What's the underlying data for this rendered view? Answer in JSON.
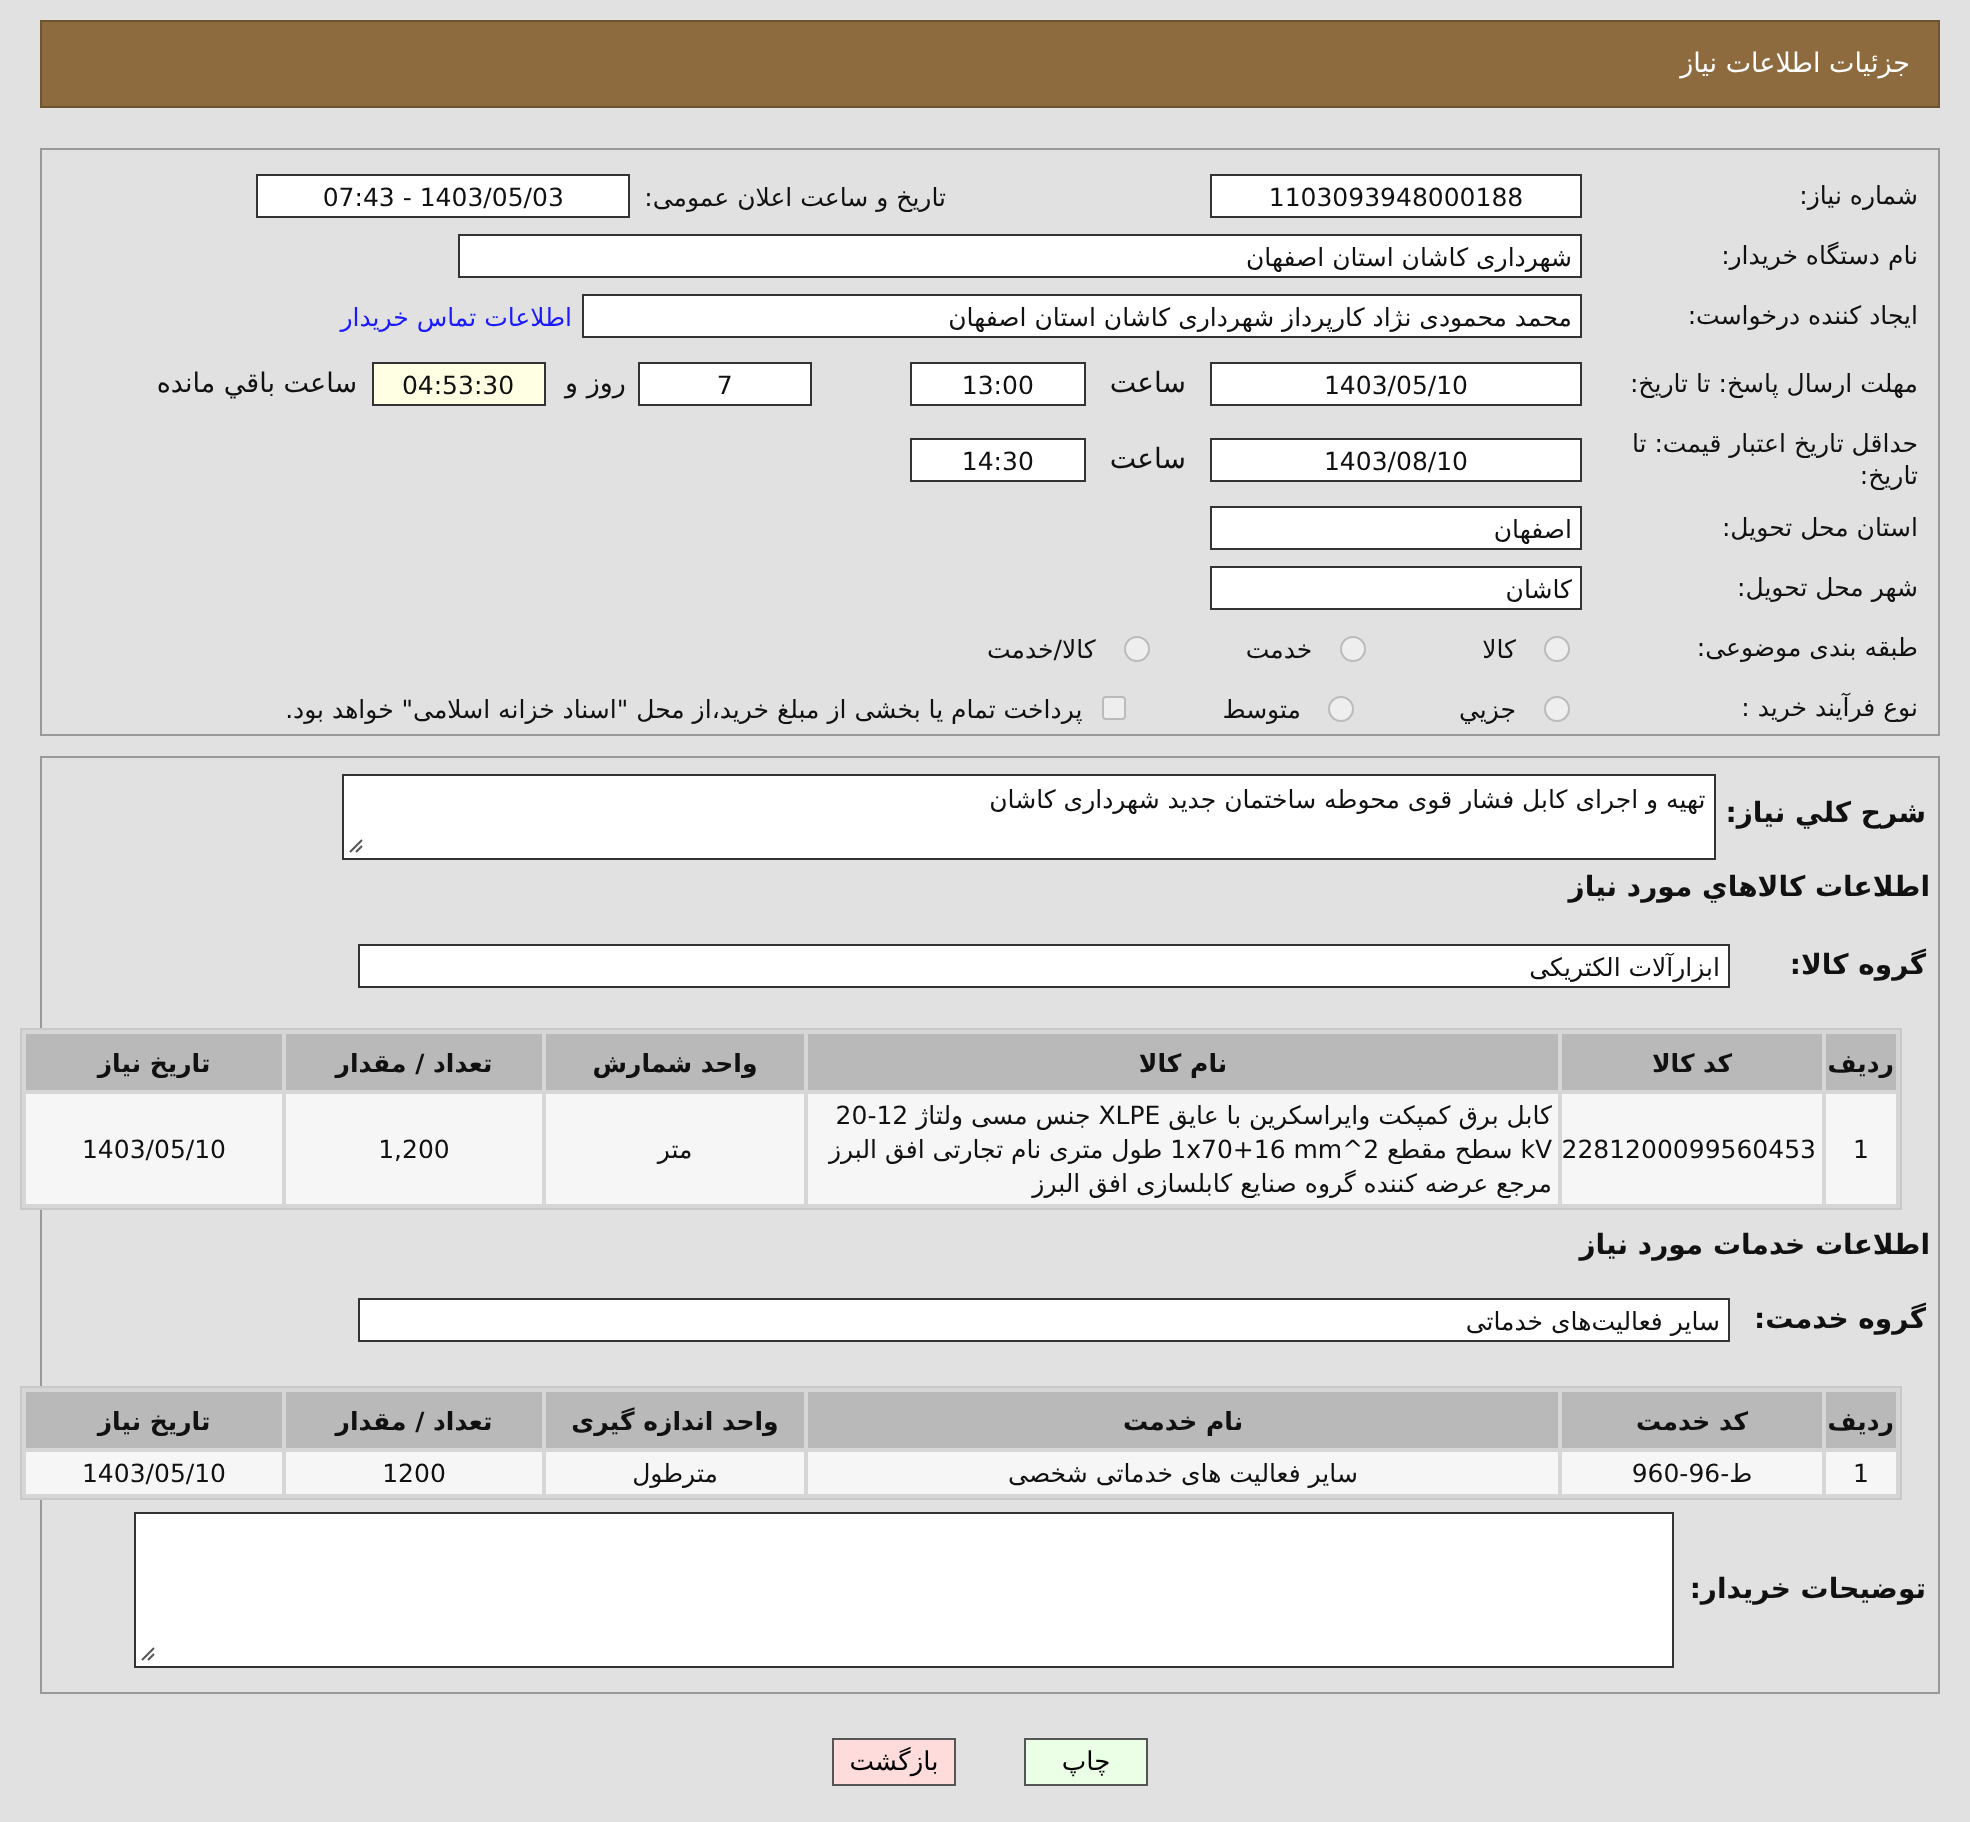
{
  "header": {
    "title": "جزئیات اطلاعات نیاز"
  },
  "info": {
    "need_number": {
      "label": "شماره نیاز:",
      "value": "1103093948000188"
    },
    "announce": {
      "label": "تاریخ و ساعت اعلان عمومی:",
      "value": "1403/05/03 - 07:43"
    },
    "buyer_org": {
      "label": "نام دستگاه خریدار:",
      "value": "شهرداری کاشان استان اصفهان"
    },
    "creator": {
      "label": "ایجاد کننده درخواست:",
      "value": "محمد محمودی نژاد کارپرداز شهرداری کاشان استان اصفهان",
      "link": "اطلاعات تماس خریدار"
    },
    "reply_deadline": {
      "label": "مهلت ارسال پاسخ: تا تاریخ:",
      "date": "1403/05/10",
      "time_label": "ساعت",
      "time": "13:00",
      "days": "7",
      "days_label": "روز و",
      "remaining": "04:53:30",
      "remaining_label": "ساعت باقي مانده"
    },
    "price_validity": {
      "label": "حداقل تاریخ اعتبار قیمت: تا تاریخ:",
      "date": "1403/08/10",
      "time_label": "ساعت",
      "time": "14:30"
    },
    "province": {
      "label": "استان محل تحویل:",
      "value": "اصفهان"
    },
    "city": {
      "label": "شهر محل تحویل:",
      "value": "کاشان"
    },
    "category": {
      "label": "طبقه بندی موضوعی:",
      "options": [
        {
          "label": "کالا",
          "selected": false
        },
        {
          "label": "خدمت",
          "selected": false
        },
        {
          "label": "کالا/خدمت",
          "selected": false
        }
      ]
    },
    "process": {
      "label": "نوع فرآیند خرید :",
      "options": [
        {
          "label": "جزيي",
          "selected": false
        },
        {
          "label": "متوسط",
          "selected": false
        }
      ],
      "treasury": {
        "label": "پرداخت تمام يا بخشی از مبلغ خرید،از محل \"اسناد خزانه اسلامی\" خواهد بود.",
        "checked": false
      }
    }
  },
  "details": {
    "summary": {
      "label": "شرح کلي نیاز:",
      "value": "تهیه و اجرای کابل فشار قوی محوطه ساختمان جدید شهرداری کاشان"
    },
    "goods": {
      "heading": "اطلاعات كالاهاي مورد نیاز",
      "group_label": "گروه کالا:",
      "group": "ابزارآلات الکتریکی",
      "columns": [
        "ردیف",
        "کد کالا",
        "نام کالا",
        "واحد شمارش",
        "تعداد / مقدار",
        "تاریخ نیاز"
      ],
      "rows": [
        [
          "1",
          "2281200099560453",
          "کابل برق کمپکت وایراسکرین با عایق XLPE جنس مسی ولتاژ 12-20 kV سطح مقطع 2^1x70+16 mm طول متری نام تجارتی افق البرز مرجع عرضه کننده گروه صنایع کابلسازی افق البرز",
          "متر",
          "1,200",
          "1403/05/10"
        ]
      ]
    },
    "services": {
      "heading": "اطلاعات خدمات مورد نیاز",
      "group_label": "گروه خدمت:",
      "group": "سایر فعالیت‌های خدماتی",
      "columns": [
        "ردیف",
        "کد خدمت",
        "نام خدمت",
        "واحد اندازه گیری",
        "تعداد / مقدار",
        "تاریخ نیاز"
      ],
      "rows": [
        [
          "1",
          "ط-96-960",
          "سایر فعالیت های خدماتی شخصی",
          "مترطول",
          "1200",
          "1403/05/10"
        ]
      ]
    },
    "buyer_notes": {
      "label": "توضیحات خریدار:"
    }
  },
  "buttons": [
    {
      "label": "چاپ",
      "kind": "print"
    },
    {
      "label": "بازگشت",
      "kind": "back"
    }
  ]
}
